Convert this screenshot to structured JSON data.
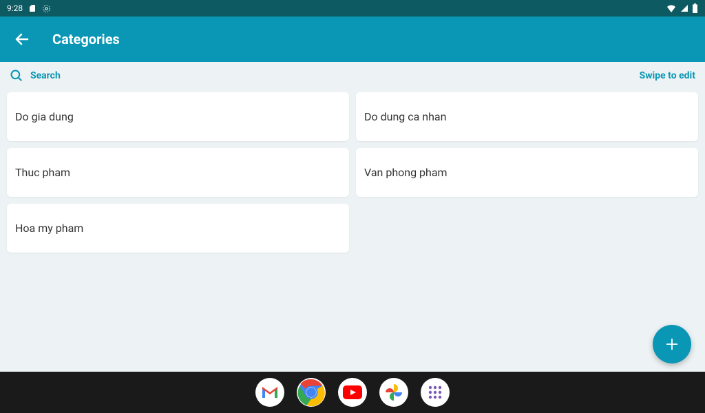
{
  "status": {
    "time": "9:28"
  },
  "header": {
    "title": "Categories"
  },
  "search": {
    "label": "Search",
    "swipe_label": "Swipe to edit"
  },
  "categories": [
    {
      "name": "Do gia dung"
    },
    {
      "name": "Do dung ca nhan"
    },
    {
      "name": "Thuc pham"
    },
    {
      "name": "Van phong pham"
    },
    {
      "name": "Hoa my pham"
    }
  ]
}
